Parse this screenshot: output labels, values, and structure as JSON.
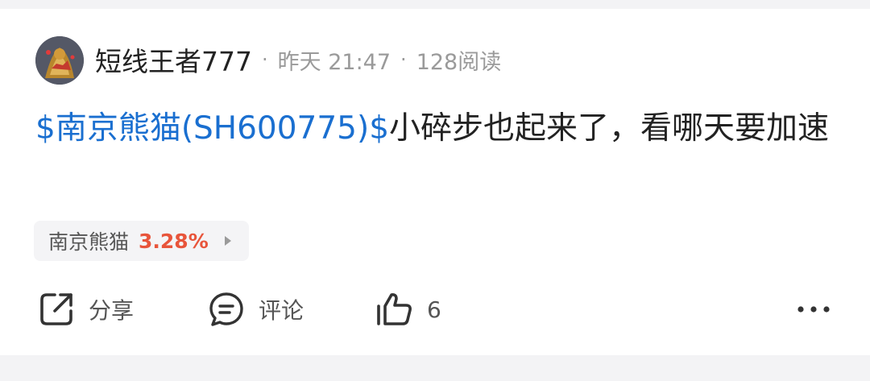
{
  "post": {
    "username": "短线王者777",
    "time": "昨天 21:47",
    "reads": "128阅读",
    "separator": "·",
    "stock_link": "$南京熊猫(SH600775)$",
    "text": "小碎步也起来了，看哪天要加速"
  },
  "stock_chip": {
    "name": "南京熊猫",
    "change": "3.28%",
    "change_color": "#e8553b"
  },
  "actions": {
    "share_label": "分享",
    "comment_label": "评论",
    "like_count": "6",
    "more_icon": "more-dots-icon"
  },
  "colors": {
    "link": "#1a6fd0",
    "muted": "#9a9a9a",
    "text": "#222222"
  }
}
